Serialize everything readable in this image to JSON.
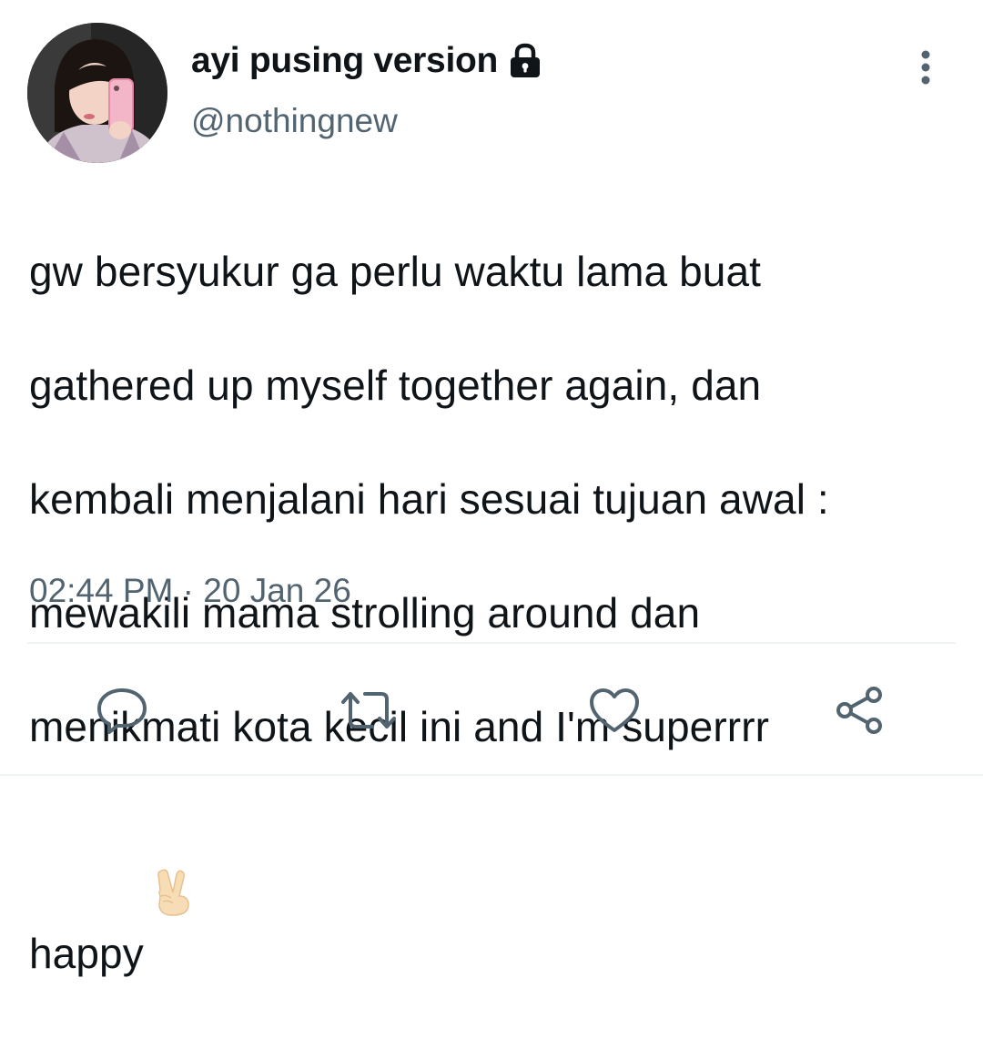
{
  "tweet": {
    "display_name": "ayi pusing version",
    "handle": "@nothingnew",
    "protected_icon": "lock-icon",
    "more_icon": "more-vertical-icon",
    "text_lines": [
      "gw bersyukur ga perlu waktu lama buat",
      "gathered up myself together again, dan",
      "kembali menjalani hari sesuai tujuan awal :",
      "mewakili mama strolling around dan",
      "menikmati kota kecil ini and I'm superrrr",
      "happy"
    ],
    "emoji": "✌🏻",
    "time": "02:44 PM",
    "separator": "·",
    "date": "20 Jan 26"
  },
  "actions": [
    {
      "name": "reply",
      "icon": "comment-icon"
    },
    {
      "name": "retweet",
      "icon": "retweet-icon"
    },
    {
      "name": "like",
      "icon": "heart-icon"
    },
    {
      "name": "share",
      "icon": "share-icon"
    }
  ],
  "colors": {
    "text": "#0f1419",
    "secondary": "#536471",
    "divider": "#eff3f4"
  }
}
